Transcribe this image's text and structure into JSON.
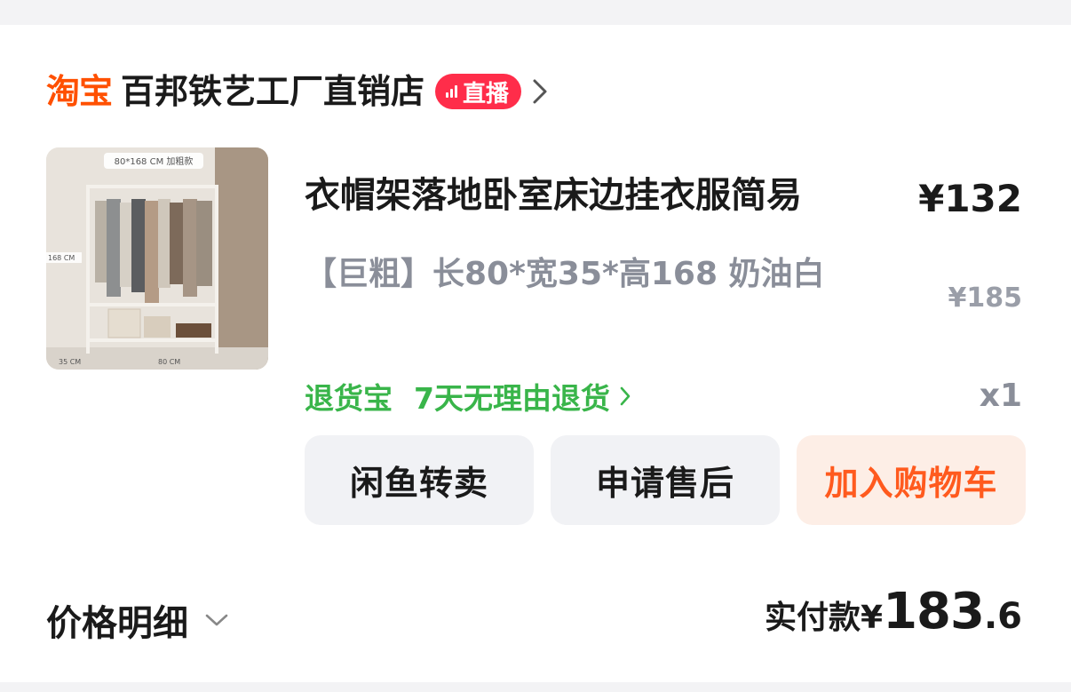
{
  "store": {
    "platform_logo": "淘宝",
    "name": "百邦铁艺工厂直销店",
    "live_label": "直播"
  },
  "product": {
    "title": "衣帽架落地卧室床边挂衣服简易",
    "price": "¥132",
    "spec": "【巨粗】长80*宽35*高168 奶油白",
    "original_price": "¥185",
    "quantity": "x1",
    "thumbnail": {
      "top_label": "80*168 CM 加粗款",
      "height_label": "168 CM",
      "depth_label": "35 CM",
      "width_label": "80 CM"
    }
  },
  "return_service": {
    "name": "退货宝",
    "policy": "7天无理由退货"
  },
  "actions": {
    "resell": "闲鱼转卖",
    "after_sales": "申请售后",
    "add_to_cart": "加入购物车"
  },
  "summary": {
    "price_detail": "价格明细",
    "paid_label": "实付款",
    "paid_currency": "¥",
    "paid_int": "183",
    "paid_dec": ".6"
  },
  "colors": {
    "taobao_orange": "#ff5000",
    "live_red": "#ff2d4a",
    "green": "#39b54a",
    "cart_orange": "#ff5a1e"
  }
}
